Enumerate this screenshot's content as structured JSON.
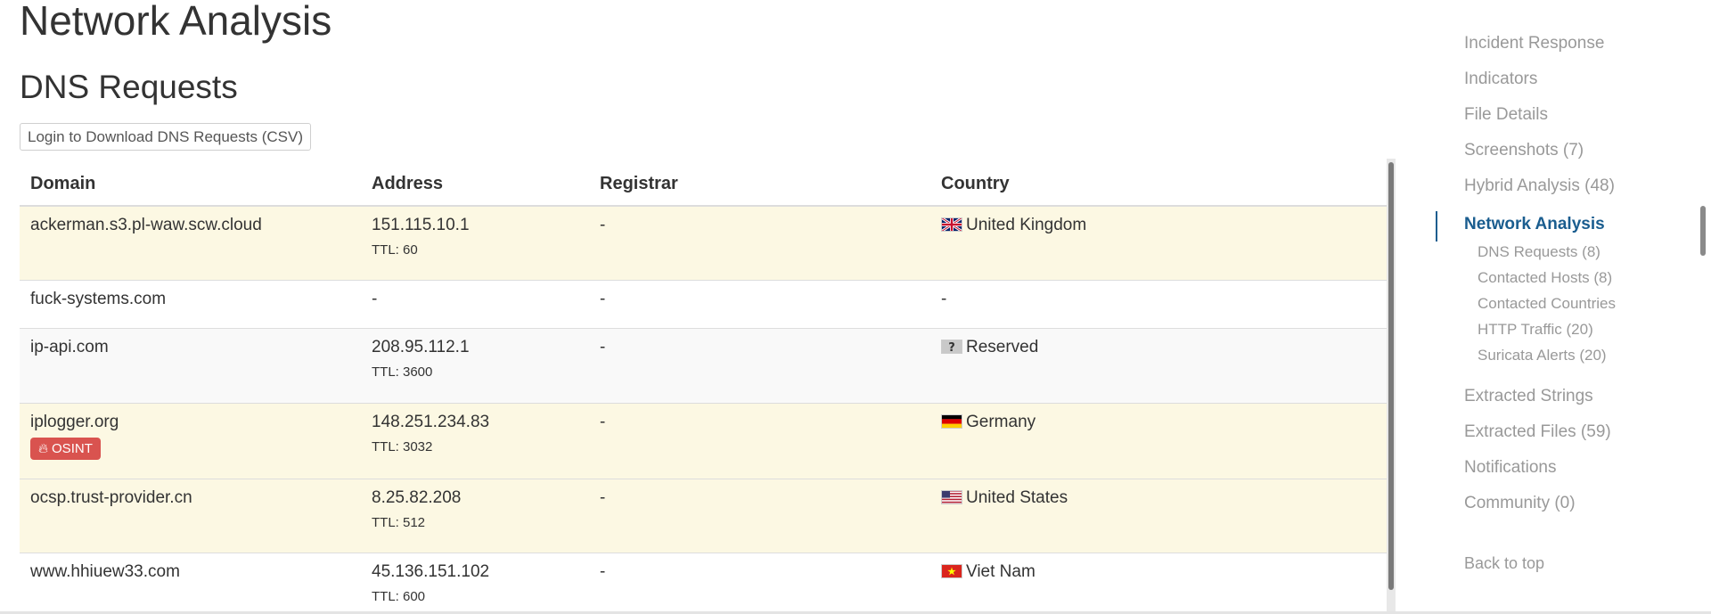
{
  "page": {
    "title": "Network Analysis"
  },
  "dns": {
    "title": "DNS Requests",
    "download_label": "Login to Download DNS Requests (CSV)",
    "columns": {
      "domain": "Domain",
      "address": "Address",
      "registrar": "Registrar",
      "country": "Country"
    },
    "rows": [
      {
        "domain": "ackerman.s3.pl-waw.scw.cloud",
        "address": "151.115.10.1",
        "ttl": "TTL: 60",
        "registrar": "-",
        "country": "United Kingdom",
        "flag_icon": "uk-flag-icon",
        "style": "warning"
      },
      {
        "domain": "fuck-systems.com",
        "address": "-",
        "ttl": "",
        "registrar": "-",
        "country": "-",
        "flag_icon": "",
        "style": "plain"
      },
      {
        "domain": "ip-api.com",
        "address": "208.95.112.1",
        "ttl": "TTL: 3600",
        "registrar": "-",
        "country": "Reserved",
        "flag_icon": "unknown-flag-icon",
        "style": "striped"
      },
      {
        "domain": "iplogger.org",
        "badge": "OSINT",
        "badge_icon": "fire-icon",
        "address": "148.251.234.83",
        "ttl": "TTL: 3032",
        "registrar": "-",
        "country": "Germany",
        "flag_icon": "germany-flag-icon",
        "style": "warning"
      },
      {
        "domain": "ocsp.trust-provider.cn",
        "address": "8.25.82.208",
        "ttl": "TTL: 512",
        "registrar": "-",
        "country": "United States",
        "flag_icon": "us-flag-icon",
        "style": "warning"
      },
      {
        "domain": "www.hhiuew33.com",
        "address": "45.136.151.102",
        "ttl": "TTL: 600",
        "registrar": "-",
        "country": "Viet Nam",
        "flag_icon": "vietnam-flag-icon",
        "style": "plain"
      }
    ]
  },
  "sidebar": {
    "items": [
      {
        "label": "Incident Response"
      },
      {
        "label": "Indicators"
      },
      {
        "label": "File Details"
      },
      {
        "label": "Screenshots (7)"
      },
      {
        "label": "Hybrid Analysis (48)"
      },
      {
        "label": "Network Analysis",
        "active": true
      },
      {
        "label": "Extracted Strings"
      },
      {
        "label": "Extracted Files (59)"
      },
      {
        "label": "Notifications"
      },
      {
        "label": "Community (0)"
      }
    ],
    "subitems": [
      {
        "label": "DNS Requests (8)"
      },
      {
        "label": "Contacted Hosts (8)"
      },
      {
        "label": "Contacted Countries"
      },
      {
        "label": "HTTP Traffic (20)"
      },
      {
        "label": "Suricata Alerts (20)"
      }
    ],
    "back_to_top": "Back to top"
  },
  "colors": {
    "accent": "#1a5d8f",
    "warning_row": "#fcf8e3",
    "badge": "#d9534f",
    "muted_text": "#999999"
  }
}
